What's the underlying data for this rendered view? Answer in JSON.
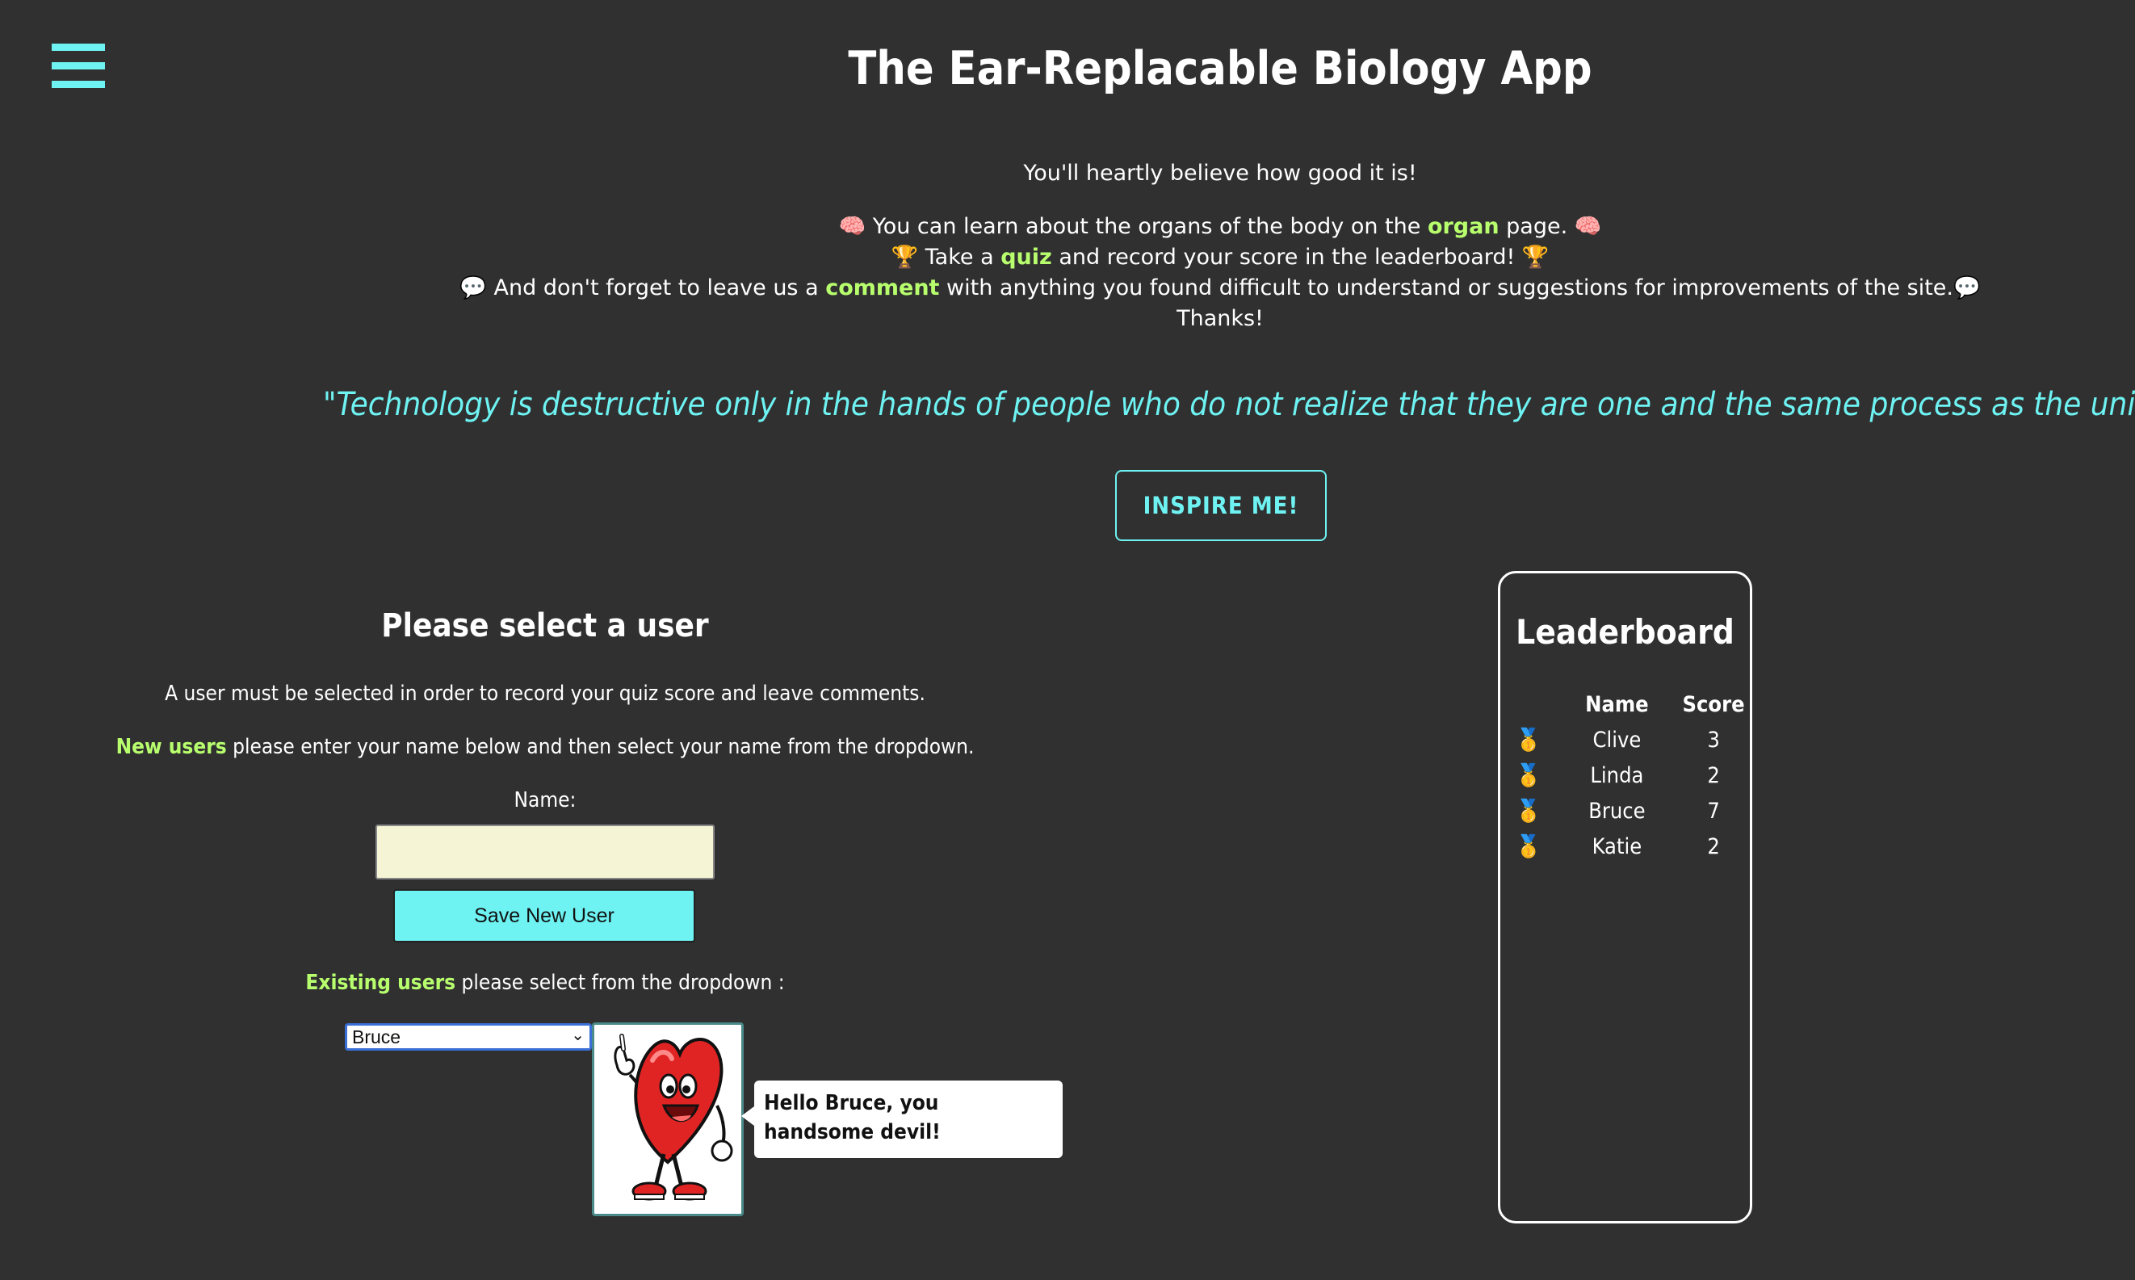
{
  "app": {
    "title": "The Ear-Replacable Biology App"
  },
  "intro": {
    "tagline": "You'll heartly believe how good it is!",
    "line1_pre": "🧠 You can learn about the organs of the body on the ",
    "line1_link": "organ",
    "line1_post": " page. 🧠",
    "line2_pre": "🏆 Take a ",
    "line2_link": "quiz",
    "line2_post": " and record your score in the leaderboard! 🏆",
    "line3_pre": "💬 And don't forget to leave us a ",
    "line3_link": "comment",
    "line3_post": " with anything you found difficult to understand or suggestions for improvements of the site.💬",
    "thanks": "Thanks!"
  },
  "quote": {
    "text": "\"Technology is destructive only in the hands of people who do not realize that they are one and the same process as the universe.\""
  },
  "inspire_button": {
    "label": "INSPIRE ME!"
  },
  "user_select": {
    "heading": "Please select a user",
    "info": "A user must be selected in order to record your quiz score and leave comments.",
    "new_users_highlight": "New users",
    "new_users_text": " please enter your name below and then select your name from the dropdown.",
    "name_label": "Name:",
    "name_value": "",
    "save_label": "Save New User",
    "existing_highlight": "Existing users",
    "existing_text": " please select from the dropdown :",
    "selected_user": "Bruce",
    "greeting": "Hello Bruce, you handsome devil!"
  },
  "leaderboard": {
    "title": "Leaderboard",
    "columns": [
      "Name",
      "Score"
    ],
    "rows": [
      {
        "medal": "🥇",
        "name": "Clive",
        "score": "3"
      },
      {
        "medal": "🥇",
        "name": "Linda",
        "score": "2"
      },
      {
        "medal": "🥇",
        "name": "Bruce",
        "score": "7"
      },
      {
        "medal": "🥇",
        "name": "Katie",
        "score": "2"
      }
    ]
  },
  "colors": {
    "accent": "#6ef2f2",
    "highlight": "#b8ff6e",
    "background": "#303030"
  },
  "icons": {
    "menu": "hamburger-menu-icon",
    "mascot": "heart-mascot-icon"
  }
}
